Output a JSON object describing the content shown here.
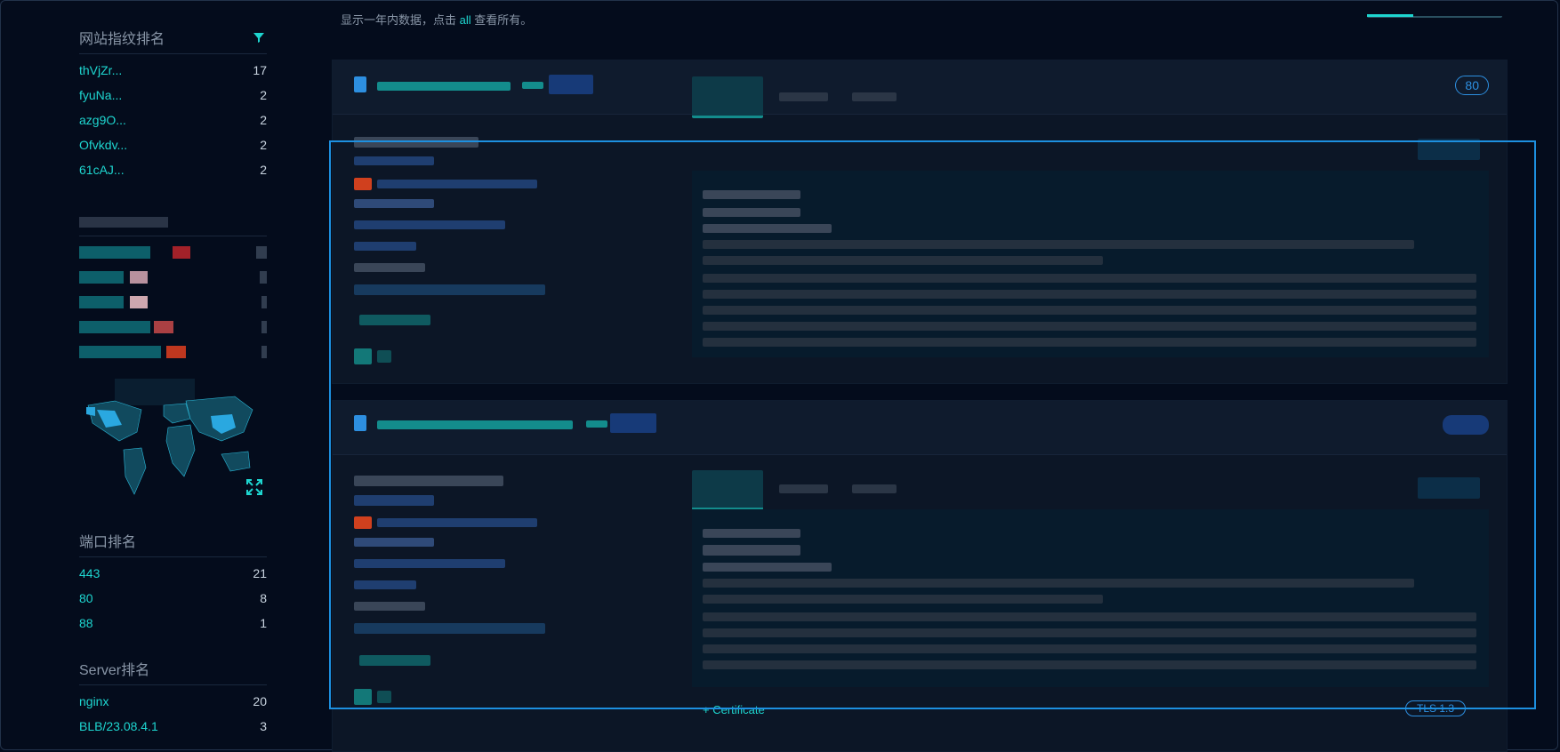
{
  "hint": {
    "text_before": "显示一年内数据，点击 ",
    "link": "all",
    "text_after": " 查看所有。"
  },
  "fingerprint_rank": {
    "title": "网站指纹排名",
    "filter_icon": "filter-icon",
    "items": [
      {
        "name": "thVjZr...",
        "count": "17"
      },
      {
        "name": "fyuNa...",
        "count": "2"
      },
      {
        "name": "azg9O...",
        "count": "2"
      },
      {
        "name": "Ofvkdv...",
        "count": "2"
      },
      {
        "name": "61cAJ...",
        "count": "2"
      }
    ]
  },
  "port_rank": {
    "title": "端口排名",
    "items": [
      {
        "name": "443",
        "count": "21"
      },
      {
        "name": "80",
        "count": "8"
      },
      {
        "name": "88",
        "count": "1"
      }
    ]
  },
  "server_rank": {
    "title": "Server排名",
    "items": [
      {
        "name": "nginx",
        "count": "20"
      },
      {
        "name": "BLB/23.08.4.1",
        "count": "3"
      }
    ]
  },
  "cards": [
    {
      "port_badge": "80"
    },
    {
      "port_badge": ""
    }
  ],
  "certificate_label": "+ Certificate",
  "tls_badge": "TLS 1.3",
  "colors": {
    "accent": "#1ed6d0",
    "highlight_border": "#1d90e0",
    "badge": "#2d8fe0",
    "background": "#040c1c"
  }
}
